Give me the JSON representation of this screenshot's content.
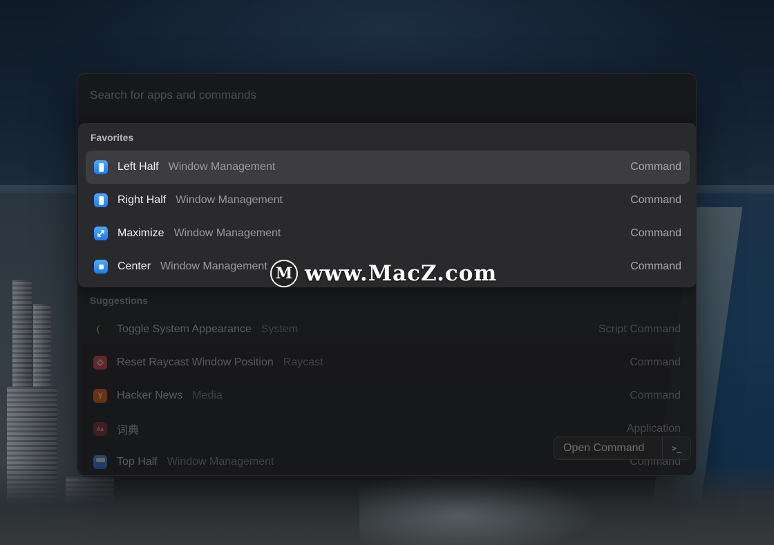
{
  "search": {
    "placeholder": "Search for apps and commands"
  },
  "favorites": {
    "label": "Favorites",
    "items": [
      {
        "title": "Left Half",
        "subtitle": "Window Management",
        "type": "Command",
        "icon": "window-left-half-icon"
      },
      {
        "title": "Right Half",
        "subtitle": "Window Management",
        "type": "Command",
        "icon": "window-right-half-icon"
      },
      {
        "title": "Maximize",
        "subtitle": "Window Management",
        "type": "Command",
        "icon": "window-maximize-icon"
      },
      {
        "title": "Center",
        "subtitle": "Window Management",
        "type": "Command",
        "icon": "window-center-icon"
      }
    ]
  },
  "suggestions": {
    "label": "Suggestions",
    "items": [
      {
        "title": "Toggle System Appearance",
        "subtitle": "System",
        "type": "Script Command",
        "icon": "moon-icon"
      },
      {
        "title": "Reset Raycast Window Position",
        "subtitle": "Raycast",
        "type": "Command",
        "icon": "raycast-logo-icon"
      },
      {
        "title": "Hacker News",
        "subtitle": "Media",
        "type": "Command",
        "icon": "hacker-news-icon"
      },
      {
        "title": "词典",
        "subtitle": "",
        "type": "Application",
        "icon": "dictionary-app-icon"
      },
      {
        "title": "Top Half",
        "subtitle": "Window Management",
        "type": "Command",
        "icon": "window-top-half-icon"
      }
    ]
  },
  "action_bar": {
    "primary_label": "Open Command",
    "icon": "terminal-icon",
    "icon_glyph": ">_"
  },
  "watermark": {
    "logo_letter": "M",
    "text": "www.MacZ.com"
  },
  "colors": {
    "accent": "#1d7cf2",
    "selected_row": "#3d3d40",
    "panel": "#2a2a2c"
  }
}
